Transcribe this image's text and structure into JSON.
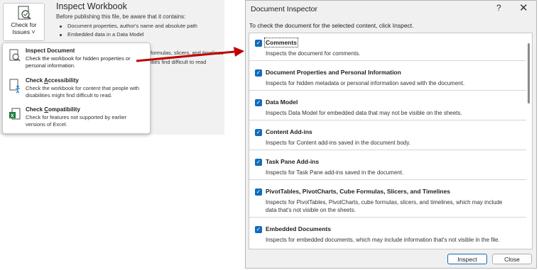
{
  "backstage": {
    "check_button": {
      "line1": "Check for",
      "line2": "Issues ˅"
    },
    "title": "Inspect Workbook",
    "description": "Before publishing this file, be aware that it contains:",
    "items": [
      "Document properties, author's name and absolute path",
      "Embedded data in a Data Model"
    ],
    "partial_text_1": "formulas, slicers, and timelines",
    "partial_text_2": "ities find difficult to read"
  },
  "menu": {
    "items": [
      {
        "title": "Inspect Document",
        "desc": "Check the workbook for hidden properties or personal information."
      },
      {
        "title": "Check Accessibility",
        "desc": "Check the workbook for content that people with disabilities might find difficult to read."
      },
      {
        "title": "Check Compatibility",
        "desc": "Check for features not supported by earlier versions of Excel."
      }
    ]
  },
  "dialog": {
    "title": "Document Inspector",
    "help": "?",
    "close": "✕",
    "instructions": "To check the document for the selected content, click Inspect.",
    "rows": [
      {
        "title": "Comments",
        "desc": "Inspects the document for comments."
      },
      {
        "title": "Document Properties and Personal Information",
        "desc": "Inspects for hidden metadata or personal information saved with the document."
      },
      {
        "title": "Data Model",
        "desc": "Inspects Data Model for embedded data that may not be visible on the sheets."
      },
      {
        "title": "Content Add-ins",
        "desc": "Inspects for Content add-ins saved in the document body."
      },
      {
        "title": "Task Pane Add-ins",
        "desc": "Inspects for Task Pane add-ins saved in the document."
      },
      {
        "title": "PivotTables, PivotCharts, Cube Formulas, Slicers, and Timelines",
        "desc": "Inspects for PivotTables, PivotCharts, cube formulas, slicers, and timelines, which may include data that's not visible on the sheets."
      },
      {
        "title": "Embedded Documents",
        "desc": "Inspects for embedded documents, which may include information that's not visible in the file."
      }
    ],
    "inspect_button": "Inspect",
    "close_button": "Close"
  },
  "colors": {
    "accent": "#0f6cbd",
    "arrow": "#c00000"
  }
}
